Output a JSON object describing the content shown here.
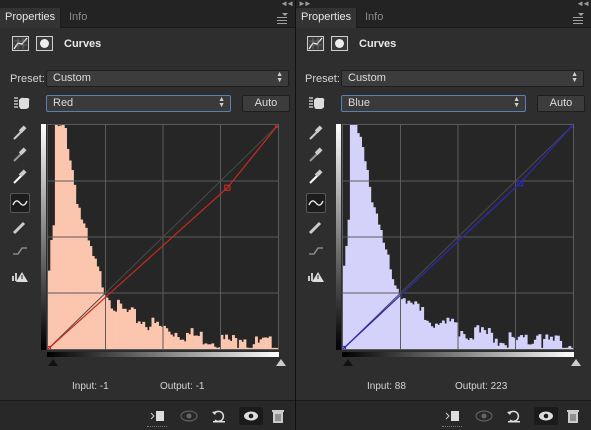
{
  "panels": [
    {
      "id": "left",
      "tabs": [
        {
          "label": "Properties"
        },
        {
          "label": "Info"
        }
      ],
      "header_title": "Curves",
      "preset_label": "Preset:",
      "preset_value": "Custom",
      "channel_value": "Red",
      "auto_label": "Auto",
      "input_text": "Input:  -1",
      "output_text": "Output:  -1",
      "histogram_color": "#fbc5ae",
      "curve_color": "#c62a1e",
      "curve_points": [
        [
          0,
          0
        ],
        [
          78,
          72
        ],
        [
          100,
          100
        ]
      ]
    },
    {
      "id": "right",
      "tabs": [
        {
          "label": "Properties"
        },
        {
          "label": "Info"
        }
      ],
      "header_title": "Curves",
      "preset_label": "Preset:",
      "preset_value": "Custom",
      "channel_value": "Blue",
      "auto_label": "Auto",
      "input_text": "Input:  88",
      "output_text": "Output:  223",
      "histogram_color": "#d4d2fb",
      "curve_color": "#2a2ab8",
      "curve_points": [
        [
          0,
          0
        ],
        [
          77,
          74
        ],
        [
          100,
          100
        ]
      ]
    }
  ],
  "icons": {
    "curves_layer": "curves-graph-icon",
    "mask": "layer-mask-icon",
    "on_image_adjust": "hand-adjust-icon",
    "tools": [
      "black-point-eyedropper-icon",
      "gray-point-eyedropper-icon",
      "white-point-eyedropper-icon",
      "curve-point-tool-icon",
      "pencil-draw-icon",
      "smooth-curve-icon",
      "clipping-warning-icon"
    ],
    "bottom": [
      "clip-to-layer-icon",
      "view-previous-state-icon",
      "reset-icon",
      "visibility-eye-icon",
      "delete-trash-icon"
    ]
  }
}
